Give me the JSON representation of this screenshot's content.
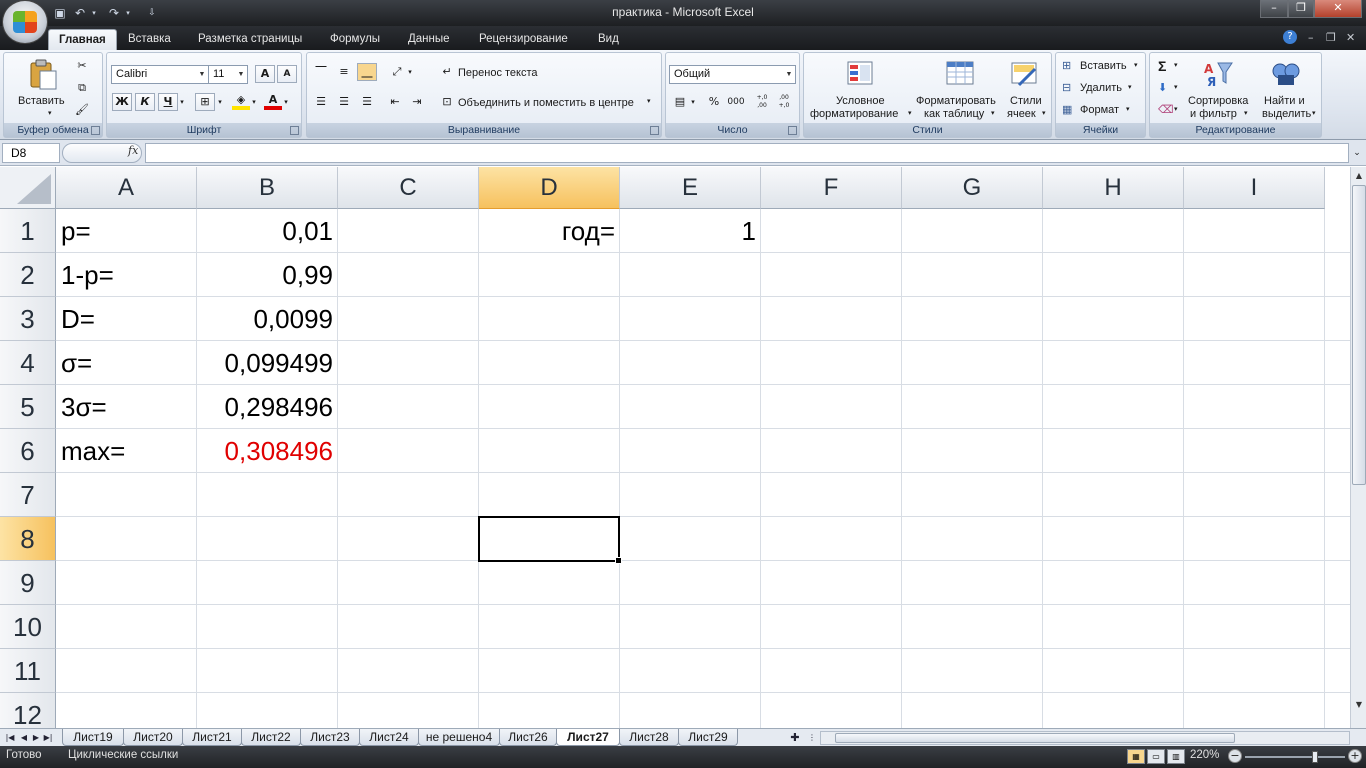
{
  "window": {
    "title": "практика - Microsoft Excel",
    "controls": [
      "–",
      "❐",
      "✕"
    ]
  },
  "quick_access": [
    "save-icon",
    "undo-icon",
    "redo-icon",
    "customize-icon"
  ],
  "tabs": [
    "Главная",
    "Вставка",
    "Разметка страницы",
    "Формулы",
    "Данные",
    "Рецензирование",
    "Вид"
  ],
  "active_tab": "Главная",
  "ribbon": {
    "clipboard": {
      "label": "Буфер обмена",
      "paste": "Вставить"
    },
    "font": {
      "label": "Шрифт",
      "font_name": "Calibri",
      "font_size": "11",
      "bold": "Ж",
      "italic": "К",
      "underline": "Ч",
      "grow": "A",
      "shrink": "A"
    },
    "alignment": {
      "label": "Выравнивание",
      "wrap": "Перенос текста",
      "merge": "Объединить и поместить в центре"
    },
    "number": {
      "label": "Число",
      "format": "Общий",
      "percent": "%",
      "thousands": "000",
      "inc_dec": "+,0\n,00",
      "dec_dec": ",00\n+,0"
    },
    "styles": {
      "label": "Стили",
      "conditional": [
        "Условное",
        "форматирование"
      ],
      "as_table": [
        "Форматировать",
        "как таблицу"
      ],
      "cell_styles": [
        "Стили",
        "ячеек"
      ]
    },
    "cells": {
      "label": "Ячейки",
      "insert": "Вставить",
      "delete": "Удалить",
      "format": "Формат"
    },
    "editing": {
      "label": "Редактирование",
      "sum": "Σ",
      "sort": [
        "Сортировка",
        "и фильтр"
      ],
      "find": [
        "Найти и",
        "выделить"
      ]
    }
  },
  "formula_bar": {
    "name_box": "D8",
    "fx": "fx",
    "formula": ""
  },
  "grid": {
    "columns": [
      "A",
      "B",
      "C",
      "D",
      "E",
      "F",
      "G",
      "H",
      "I"
    ],
    "rows": [
      "1",
      "2",
      "3",
      "4",
      "5",
      "6",
      "7",
      "8",
      "9",
      "10",
      "11",
      "12"
    ],
    "selected_cell": "D8",
    "cells": {
      "A1": "p=",
      "B1": "0,01",
      "D1": "год=",
      "E1": "1",
      "A2": "1-p=",
      "B2": "0,99",
      "A3": "D=",
      "B3": "0,0099",
      "A4": "σ=",
      "B4": "0,099499",
      "A5": "3σ=",
      "B5": "0,298496",
      "A6": "max=",
      "B6": "0,308496"
    },
    "highlight_color": "#e00000"
  },
  "sheets": [
    "Лист19",
    "Лист20",
    "Лист21",
    "Лист22",
    "Лист23",
    "Лист24",
    "не решено4",
    "Лист26",
    "Лист27",
    "Лист28",
    "Лист29"
  ],
  "active_sheet": "Лист27",
  "status": {
    "ready": "Готово",
    "circular": "Циклические ссылки",
    "zoom": "220%"
  }
}
